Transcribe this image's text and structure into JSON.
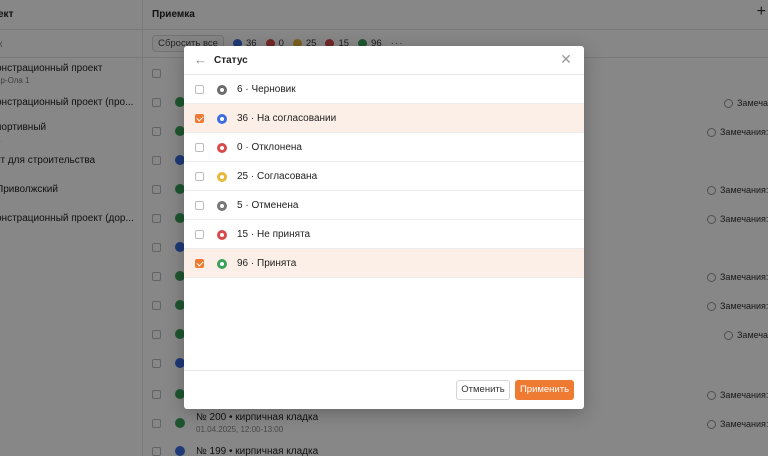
{
  "header": {
    "left_label": "ект",
    "title": "Приемка",
    "add_symbol": "+"
  },
  "toolbar": {
    "left_label": "к",
    "reset_label": "Сбросить все",
    "counters": [
      {
        "value": "36",
        "color": "#3b6de0"
      },
      {
        "value": "0",
        "color": "#d94b4b"
      },
      {
        "value": "25",
        "color": "#e8b83a"
      },
      {
        "value": "15",
        "color": "#d94b4b"
      },
      {
        "value": "96",
        "color": "#3aa35b"
      }
    ],
    "more": "···"
  },
  "left_rows": [
    {
      "title": "онстрационный проект",
      "sub": "ар-Ола 1"
    },
    {
      "title": "онстрационный проект (про...",
      "sub": ""
    },
    {
      "title": "портивный",
      "sub": "а"
    },
    {
      "title": "кт для строительства",
      "sub": ""
    },
    {
      "title": "Приволжский",
      "sub": ""
    },
    {
      "title": "онстрационный проект (дор...",
      "sub": ""
    }
  ],
  "right_rows": [
    {
      "title": "№ 200 • кирпичная кладка",
      "sub": "01.04.2025, 12:00-13:00"
    },
    {
      "title": "№ 199 • кирпичная кладка",
      "sub": ""
    }
  ],
  "remarks": [
    {
      "text": "Замечани"
    },
    {
      "text": "Замечания: 1"
    },
    {
      "text": "Замечания: 1"
    },
    {
      "text": "Замечания: 1"
    },
    {
      "text": "Замечания: 1"
    },
    {
      "text": "Замечания: 2"
    },
    {
      "text": "Замечани"
    },
    {
      "text": "Замечания: 1"
    },
    {
      "text": "Замечания: 1"
    }
  ],
  "modal": {
    "title": "Статус",
    "options": [
      {
        "label": "6 · Черновик",
        "color": "#6b6b6b",
        "selected": false
      },
      {
        "label": "36 · На согласовании",
        "color": "#3b6de0",
        "selected": true
      },
      {
        "label": "0 · Отклонена",
        "color": "#d94b4b",
        "selected": false
      },
      {
        "label": "25 · Согласована",
        "color": "#e8b83a",
        "selected": false
      },
      {
        "label": "5 · Отменена",
        "color": "#777777",
        "selected": false
      },
      {
        "label": "15 · Не принята",
        "color": "#d94b4b",
        "selected": false
      },
      {
        "label": "96 · Принята",
        "color": "#3aa35b",
        "selected": true
      }
    ],
    "cancel_label": "Отменить",
    "apply_label": "Применить"
  },
  "colors": {
    "accent": "#ef7b32",
    "selected_row": "#fcefe7"
  }
}
